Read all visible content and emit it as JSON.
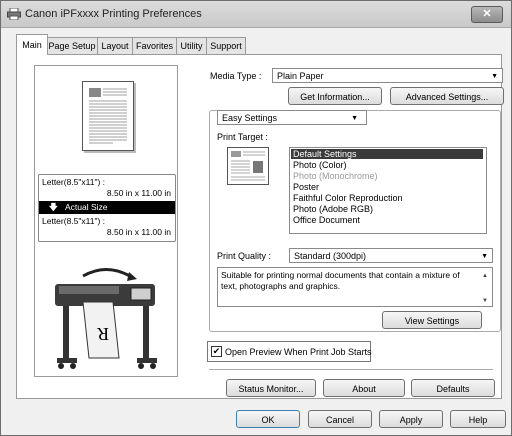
{
  "window": {
    "title": "Canon iPFxxxx Printing Preferences",
    "close_label": "✕"
  },
  "tabs": [
    "Main",
    "Page Setup",
    "Layout",
    "Favorites",
    "Utility",
    "Support"
  ],
  "preview": {
    "size_top_label": "Letter(8.5\"x11\") :",
    "size_top_value": "8.50 in x 11.00 in",
    "actual_size": "Actual Size",
    "size_bottom_label": "Letter(8.5\"x11\") :",
    "size_bottom_value": "8.50 in x 11.00 in",
    "paper_letter": "R"
  },
  "media": {
    "label": "Media Type :",
    "value": "Plain Paper"
  },
  "buttons": {
    "get_info": "Get Information...",
    "advanced": "Advanced Settings...",
    "view_settings": "View Settings",
    "status_monitor": "Status Monitor...",
    "about": "About",
    "defaults": "Defaults",
    "ok": "OK",
    "cancel": "Cancel",
    "apply": "Apply",
    "help": "Help"
  },
  "settings_mode": {
    "value": "Easy Settings"
  },
  "print_target": {
    "label": "Print Target :",
    "items": [
      {
        "text": "Default Settings",
        "selected": true,
        "disabled": false
      },
      {
        "text": "Photo (Color)",
        "selected": false,
        "disabled": false
      },
      {
        "text": "Photo (Monochrome)",
        "selected": false,
        "disabled": true
      },
      {
        "text": "Poster",
        "selected": false,
        "disabled": false
      },
      {
        "text": "Faithful Color Reproduction",
        "selected": false,
        "disabled": false
      },
      {
        "text": "Photo (Adobe RGB)",
        "selected": false,
        "disabled": false
      },
      {
        "text": "Office Document",
        "selected": false,
        "disabled": false
      }
    ]
  },
  "print_quality": {
    "label": "Print Quality :",
    "value": "Standard (300dpi)"
  },
  "description": "Suitable for printing normal documents that contain a mixture of text, photographs and graphics.",
  "open_preview": {
    "label": "Open Preview When Print Job Starts",
    "checked": true,
    "check_mark": "✔"
  }
}
